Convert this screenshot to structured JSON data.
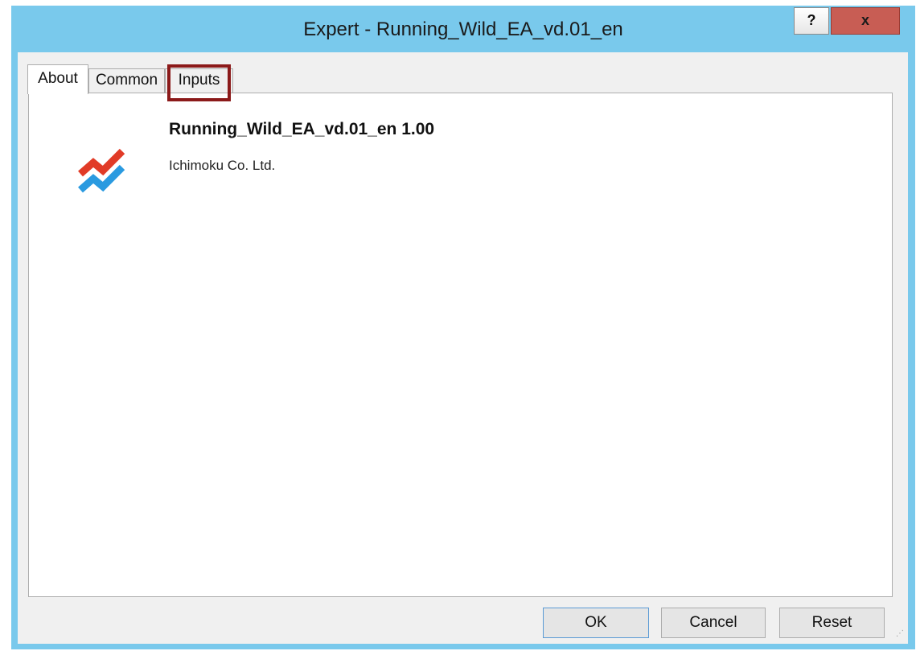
{
  "window": {
    "title": "Expert - Running_Wild_EA_vd.01_en",
    "help_label": "?",
    "close_label": "x"
  },
  "tabs": [
    {
      "label": "About",
      "active": true
    },
    {
      "label": "Common",
      "active": false
    },
    {
      "label": "Inputs",
      "active": false
    }
  ],
  "about": {
    "name_version": "Running_Wild_EA_vd.01_en 1.00",
    "company": "Ichimoku Co. Ltd.",
    "logo_icon": "expert-advisor-chart-icon",
    "logo_colors": {
      "top": "#e13b27",
      "bottom": "#2a9ae0"
    }
  },
  "buttons": {
    "ok": "OK",
    "cancel": "Cancel",
    "reset": "Reset"
  },
  "accent": {
    "titlebar": "#79c9ec",
    "highlight": "#8b1a1a",
    "close": "#c85d54"
  }
}
